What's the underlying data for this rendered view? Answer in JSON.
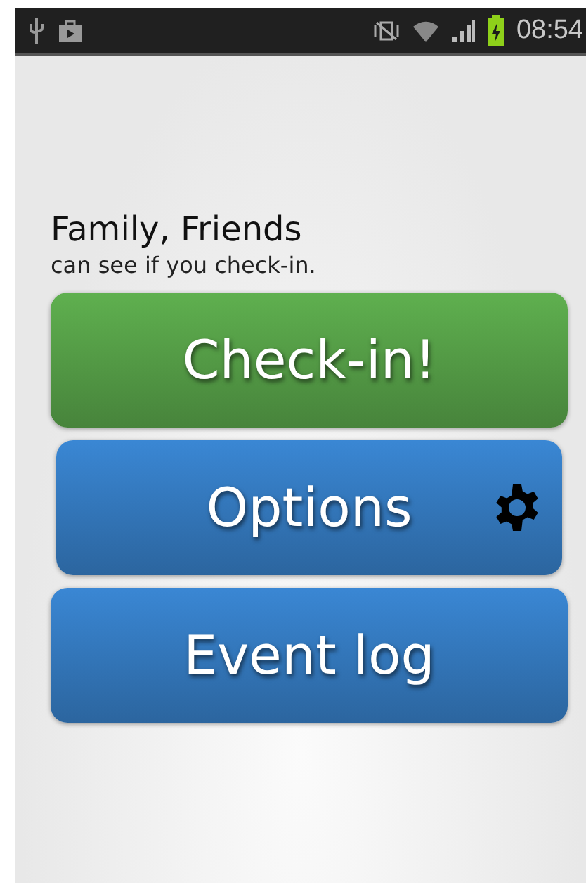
{
  "status_bar": {
    "time": "08:54"
  },
  "heading": "Family, Friends",
  "subheading": "can see if you check-in.",
  "buttons": [
    {
      "label": "Check-in!",
      "kind": "plain",
      "color": "#5fb04f"
    },
    {
      "label": "Options",
      "kind": "icon",
      "color": "#3a87d4"
    },
    {
      "label": "Event log",
      "kind": "plain",
      "color": "#3a87d4"
    }
  ]
}
